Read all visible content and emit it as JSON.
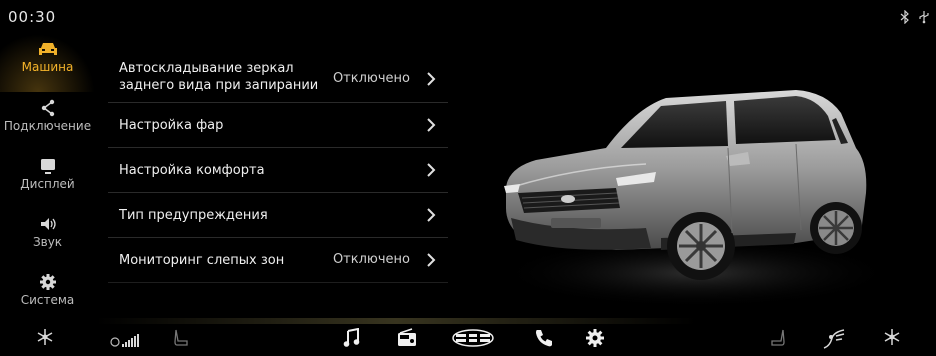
{
  "status": {
    "time": "00:30",
    "icons": [
      "bluetooth-icon",
      "usb-icon"
    ]
  },
  "sidebar": {
    "items": [
      {
        "label": "Машина",
        "icon": "car-icon",
        "active": true
      },
      {
        "label": "Подключение",
        "icon": "share-icon",
        "active": false
      },
      {
        "label": "Дисплей",
        "icon": "display-icon",
        "active": false
      },
      {
        "label": "Звук",
        "icon": "speaker-icon",
        "active": false
      },
      {
        "label": "Система",
        "icon": "gear-icon",
        "active": false
      }
    ],
    "active_color": "#f4b32a"
  },
  "settings": {
    "rows": [
      {
        "title_line1": "Автоскладывание зеркал",
        "title_line2": "заднего вида при запирании",
        "value": "Отключено"
      },
      {
        "title": "Настройка фар",
        "value": ""
      },
      {
        "title": "Настройка комфорта",
        "value": ""
      },
      {
        "title": "Тип предупреждения",
        "value": ""
      },
      {
        "title": "Мониторинг слепых зон",
        "value": "Отключено"
      }
    ]
  },
  "bottom_bar": {
    "icons": [
      "climate-left-icon",
      "fan-speed-icon",
      "seat-heat-left-icon",
      "music-icon",
      "radio-icon",
      "home-logo-icon",
      "phone-icon",
      "settings-icon",
      "seat-heat-right-icon",
      "airflow-icon",
      "climate-right-icon"
    ]
  }
}
